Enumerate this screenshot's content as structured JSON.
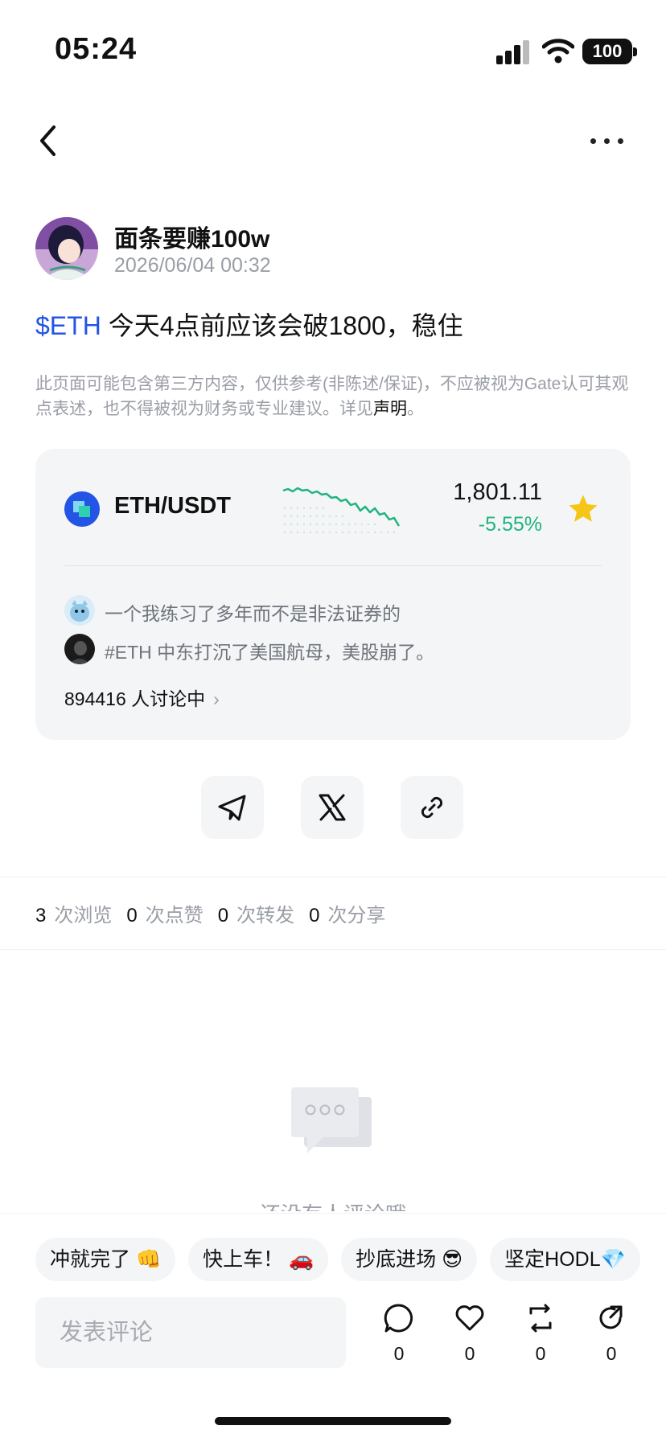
{
  "status_bar": {
    "time": "05:24",
    "battery": "100"
  },
  "author": {
    "name": "面条要赚100w",
    "timestamp": "2026/06/04 00:32"
  },
  "post": {
    "tag": "$ETH",
    "text": " 今天4点前应该会破1800，稳住"
  },
  "disclaimer": {
    "text": "此页面可能包含第三方内容，仅供参考(非陈述/保证)，不应被视为Gate认可其观点表述，也不得被视为财务或专业建议。详见",
    "link": "声明",
    "end": "。"
  },
  "market": {
    "pair": "ETH/USDT",
    "price": "1,801.11",
    "change": "-5.55%",
    "discussions": [
      {
        "text": "一个我练习了多年而不是非法证券的"
      },
      {
        "text": "#ETH 中东打沉了美国航母，美股崩了。"
      }
    ],
    "discuss_count": "894416 人讨论中",
    "colors": {
      "up_down": "#1fb47d",
      "star": "#f5c518",
      "coin": "#2354e6"
    }
  },
  "share": {
    "icons": [
      "telegram-icon",
      "x-icon",
      "link-icon"
    ]
  },
  "stats": [
    {
      "value": "3",
      "label": "次浏览"
    },
    {
      "value": "0",
      "label": "次点赞"
    },
    {
      "value": "0",
      "label": "次转发"
    },
    {
      "value": "0",
      "label": "次分享"
    }
  ],
  "empty_state": {
    "text": "还没有人评论哦"
  },
  "quick_replies": [
    "冲就完了 👊",
    "快上车！ 🚗",
    "抄底进场 😎",
    "坚定HODL💎"
  ],
  "comment_box": {
    "placeholder": "发表评论"
  },
  "actions": [
    {
      "icon": "comment-icon",
      "count": "0"
    },
    {
      "icon": "heart-icon",
      "count": "0"
    },
    {
      "icon": "repost-icon",
      "count": "0"
    },
    {
      "icon": "share-icon",
      "count": "0"
    }
  ]
}
